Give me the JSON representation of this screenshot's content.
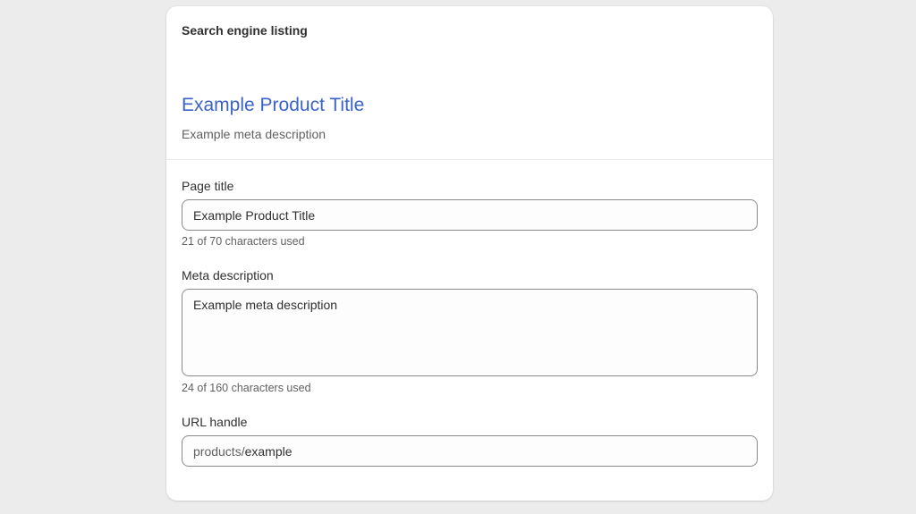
{
  "card": {
    "heading": "Search engine listing"
  },
  "preview": {
    "title": "Example Product Title",
    "description": "Example meta description"
  },
  "page_title": {
    "label": "Page title",
    "value": "Example Product Title",
    "help": "21 of 70 characters used"
  },
  "meta_description": {
    "label": "Meta description",
    "value": "Example meta description",
    "help": "24 of 160 characters used"
  },
  "url_handle": {
    "label": "URL handle",
    "prefix": "products/",
    "value": "example"
  }
}
